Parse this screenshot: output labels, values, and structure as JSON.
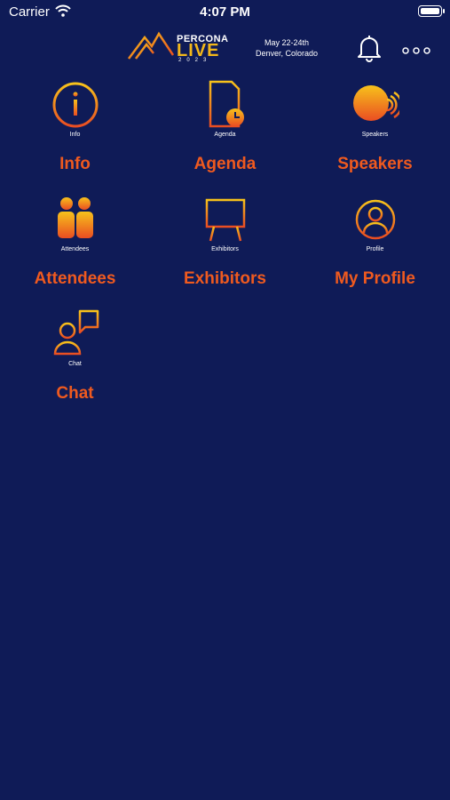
{
  "status": {
    "carrier": "Carrier",
    "time": "4:07 PM"
  },
  "header": {
    "logo_top": "PERCONA",
    "logo_mid": "LIVE",
    "logo_year": "2023",
    "date_line1": "May 22-24th",
    "date_line2": "Denver, Colorado"
  },
  "tiles": [
    {
      "caption": "Info",
      "label": "Info"
    },
    {
      "caption": "Agenda",
      "label": "Agenda"
    },
    {
      "caption": "Speakers",
      "label": "Speakers"
    },
    {
      "caption": "Attendees",
      "label": "Attendees"
    },
    {
      "caption": "Exhibitors",
      "label": "Exhibitors"
    },
    {
      "caption": "Profile",
      "label": "My Profile"
    },
    {
      "caption": "Chat",
      "label": "Chat"
    }
  ],
  "colors": {
    "background": "#0f1b57",
    "accent": "#ef5a1f",
    "icon_gold": "#f3b81a"
  }
}
